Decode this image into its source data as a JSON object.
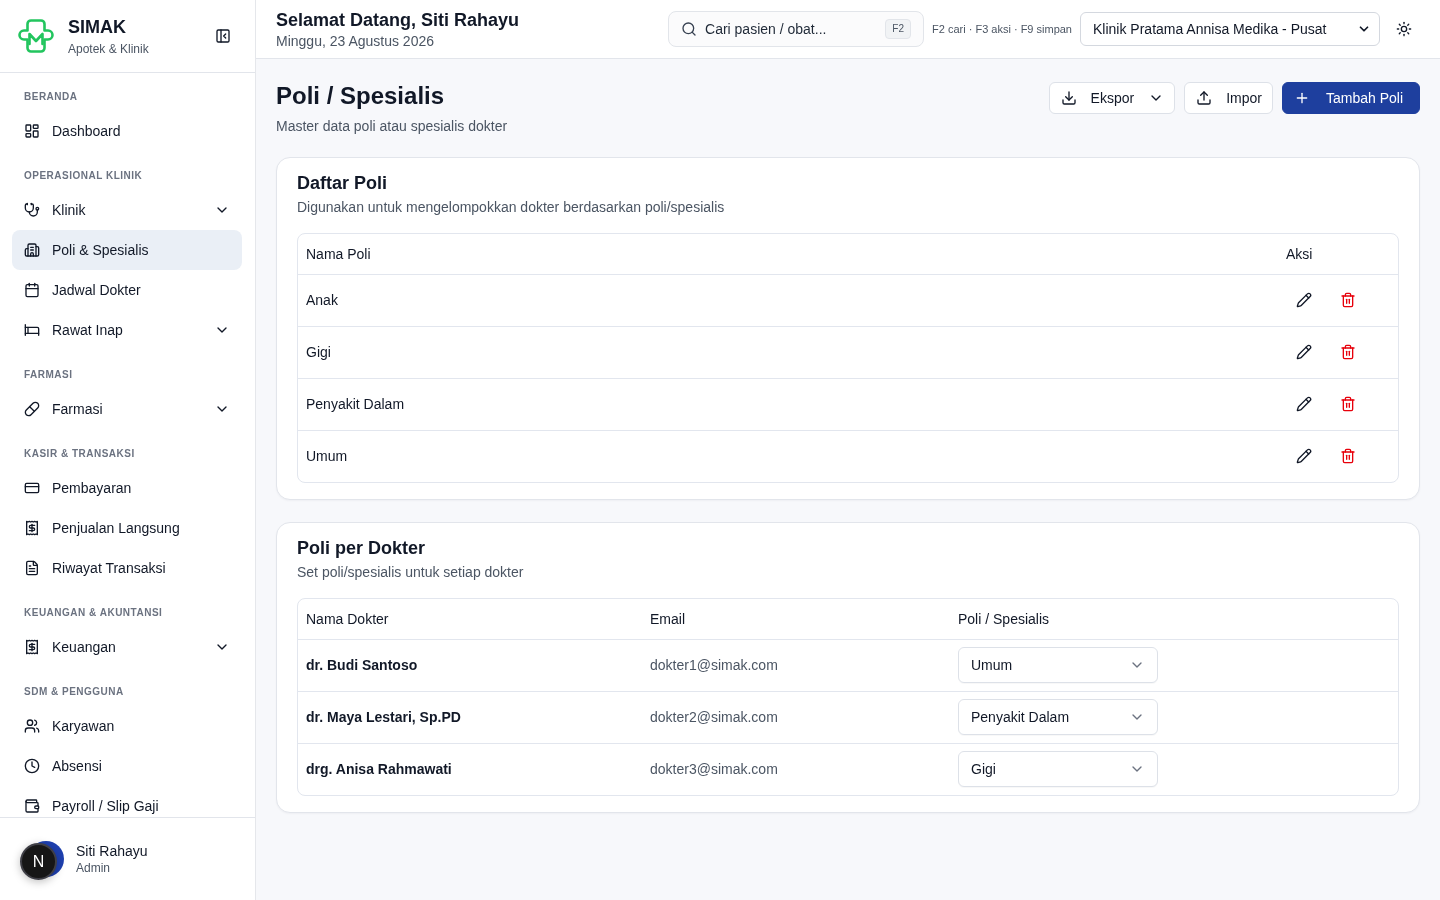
{
  "sidebar": {
    "brand": {
      "name": "SIMAK",
      "tagline": "Apotek & Klinik"
    },
    "sections": [
      {
        "title": "BERANDA",
        "items": [
          {
            "label": "Dashboard",
            "expandable": false,
            "selected": false
          }
        ]
      },
      {
        "title": "OPERASIONAL KLINIK",
        "items": [
          {
            "label": "Klinik",
            "expandable": true,
            "selected": false
          },
          {
            "label": "Poli & Spesialis",
            "expandable": false,
            "selected": true
          },
          {
            "label": "Jadwal Dokter",
            "expandable": false,
            "selected": false
          },
          {
            "label": "Rawat Inap",
            "expandable": true,
            "selected": false
          }
        ]
      },
      {
        "title": "FARMASI",
        "items": [
          {
            "label": "Farmasi",
            "expandable": true,
            "selected": false
          }
        ]
      },
      {
        "title": "KASIR & TRANSAKSI",
        "items": [
          {
            "label": "Pembayaran",
            "expandable": false,
            "selected": false
          },
          {
            "label": "Penjualan Langsung",
            "expandable": false,
            "selected": false
          },
          {
            "label": "Riwayat Transaksi",
            "expandable": false,
            "selected": false
          }
        ]
      },
      {
        "title": "KEUANGAN & AKUNTANSI",
        "items": [
          {
            "label": "Keuangan",
            "expandable": true,
            "selected": false
          }
        ]
      },
      {
        "title": "SDM & PENGGUNA",
        "items": [
          {
            "label": "Karyawan",
            "expandable": false,
            "selected": false
          },
          {
            "label": "Absensi",
            "expandable": false,
            "selected": false
          },
          {
            "label": "Payroll / Slip Gaji",
            "expandable": false,
            "selected": false
          }
        ]
      }
    ],
    "user": {
      "name": "Siti Rahayu",
      "role": "Admin"
    }
  },
  "dev_indicator": {
    "label": "N"
  },
  "header": {
    "greeting": "Selamat Datang, Siti Rahayu",
    "date": "Minggu, 23 Agustus 2026",
    "search": {
      "label": "Cari pasien / obat...",
      "shortcut": "F2"
    },
    "shortcuts_hint": "F2 cari · F3 aksi · F9 simpan",
    "clinic_select": {
      "value": "Klinik Pratama Annisa Medika - Pusat"
    }
  },
  "page": {
    "title": "Poli / Spesialis",
    "subtitle": "Master data poli atau spesialis dokter",
    "actions": [
      {
        "kind": "export",
        "label": "Ekspor"
      },
      {
        "kind": "import",
        "label": "Impor"
      },
      {
        "kind": "add",
        "label": "Tambah Poli"
      }
    ]
  },
  "poli_list": {
    "title": "Daftar Poli",
    "subtitle": "Digunakan untuk mengelompokkan dokter berdasarkan poli/spesialis",
    "columns": [
      "Nama Poli",
      "Aksi"
    ],
    "rows": [
      {
        "name": "Anak"
      },
      {
        "name": "Gigi"
      },
      {
        "name": "Penyakit Dalam"
      },
      {
        "name": "Umum"
      }
    ]
  },
  "poli_per_doctor": {
    "title": "Poli per Dokter",
    "subtitle": "Set poli/spesialis untuk setiap dokter",
    "columns": [
      "Nama Dokter",
      "Email",
      "Poli / Spesialis"
    ],
    "rows": [
      {
        "name": "dr. Budi Santoso",
        "email": "dokter1@simak.com",
        "poli": "Umum"
      },
      {
        "name": "dr. Maya Lestari, Sp.PD",
        "email": "dokter2@simak.com",
        "poli": "Penyakit Dalam"
      },
      {
        "name": "drg. Anisa Rahmawati",
        "email": "dokter3@simak.com",
        "poli": "Gigi"
      }
    ]
  }
}
